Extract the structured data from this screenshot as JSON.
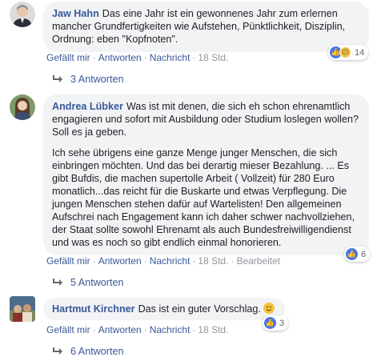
{
  "comments": [
    {
      "author": "Jaw Hahn",
      "paragraphs": [
        "Das eine Jahr ist ein gewonnenes Jahr zum erlernen mancher Grundfertigkeiten wie Aufstehen, Pünktlichkeit, Disziplin, Ordnung: eben \"Kopfnoten\"."
      ],
      "like": "Gefällt mir",
      "reply": "Antworten",
      "message": "Nachricht",
      "time": "18 Std.",
      "edited": "",
      "reaction_count": "14",
      "replies": "3 Antworten"
    },
    {
      "author": "Andrea Lübker",
      "paragraphs": [
        "Was ist mit denen, die sich eh schon ehrenamtlich engagieren und sofort mit Ausbildung oder Studium loslegen wollen? Soll es ja geben.",
        "Ich sehe übrigens eine ganze Menge junger Menschen, die sich einbringen möchten. Und das bei derartig mieser Bezahlung. ... Es gibt Bufdis, die machen supertolle Arbeit ( Vollzeit) für 280 Euro monatlich...das reicht für die Buskarte und etwas Verpflegung. Die jungen Menschen stehen dafür auf Wartelisten! Den allgemeinen Aufschrei nach Engagement kann ich daher schwer nachvollziehen, der Staat sollte sowohl Ehrenamt als auch Bundesfreiwilligendienst und was es noch so gibt endlich einmal honorieren."
      ],
      "like": "Gefällt mir",
      "reply": "Antworten",
      "message": "Nachricht",
      "time": "18 Std.",
      "edited": "Bearbeitet",
      "reaction_count": "6",
      "replies": "5 Antworten"
    },
    {
      "author": "Hartmut Kirchner",
      "paragraphs": [
        "Das ist ein guter Vorschlag."
      ],
      "like": "Gefällt mir",
      "reply": "Antworten",
      "message": "Nachricht",
      "time": "18 Std.",
      "edited": "",
      "reaction_count": "3",
      "replies": "6 Antworten"
    }
  ]
}
